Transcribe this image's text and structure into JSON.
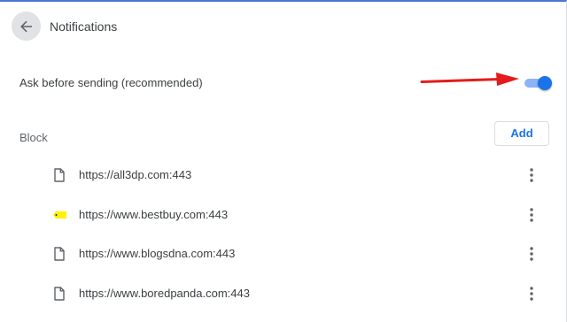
{
  "header": {
    "back_icon": "arrow-back-icon",
    "title": "Notifications"
  },
  "ask_before_sending": {
    "label": "Ask before sending (recommended)",
    "enabled": true,
    "accent_color": "#1a73e8"
  },
  "annotation": {
    "arrow_color": "#e41b1b",
    "points_to": "ask-toggle"
  },
  "block": {
    "heading": "Block",
    "add_label": "Add",
    "sites": [
      {
        "url": "https://all3dp.com:443",
        "icon": "page-icon"
      },
      {
        "url": "https://www.bestbuy.com:443",
        "icon": "bestbuy-favicon-icon"
      },
      {
        "url": "https://www.blogsdna.com:443",
        "icon": "page-icon"
      },
      {
        "url": "https://www.boredpanda.com:443",
        "icon": "page-icon"
      }
    ],
    "more_icon": "more-vert-icon"
  }
}
